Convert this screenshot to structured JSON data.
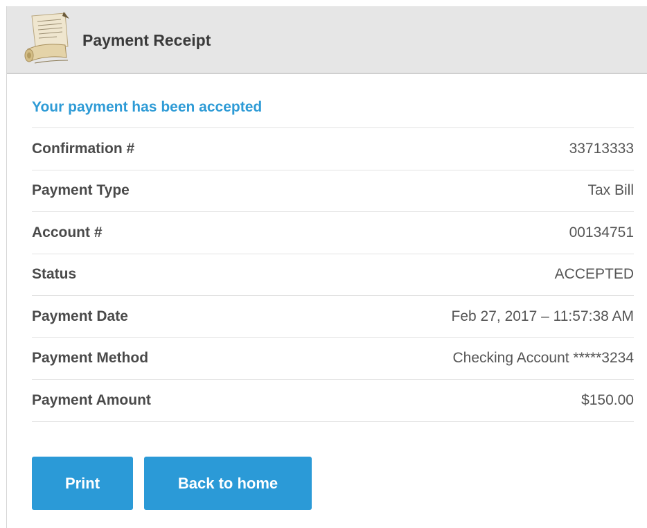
{
  "header": {
    "title": "Payment Receipt",
    "icon": "scroll-icon"
  },
  "receipt": {
    "message": "Your payment has been accepted",
    "message_color": "#2e9bd6",
    "rows": [
      {
        "label": "Confirmation #",
        "value": "33713333"
      },
      {
        "label": "Payment Type",
        "value": "Tax Bill"
      },
      {
        "label": "Account #",
        "value": "00134751"
      },
      {
        "label": "Status",
        "value": "ACCEPTED"
      },
      {
        "label": "Payment Date",
        "value": "Feb 27, 2017 – 11:57:38 AM"
      },
      {
        "label": "Payment Method",
        "value": "Checking Account *****3234"
      },
      {
        "label": "Payment Amount",
        "value": "$150.00"
      }
    ]
  },
  "actions": {
    "print_label": "Print",
    "home_label": "Back to home",
    "button_color": "#2b9ad7"
  }
}
